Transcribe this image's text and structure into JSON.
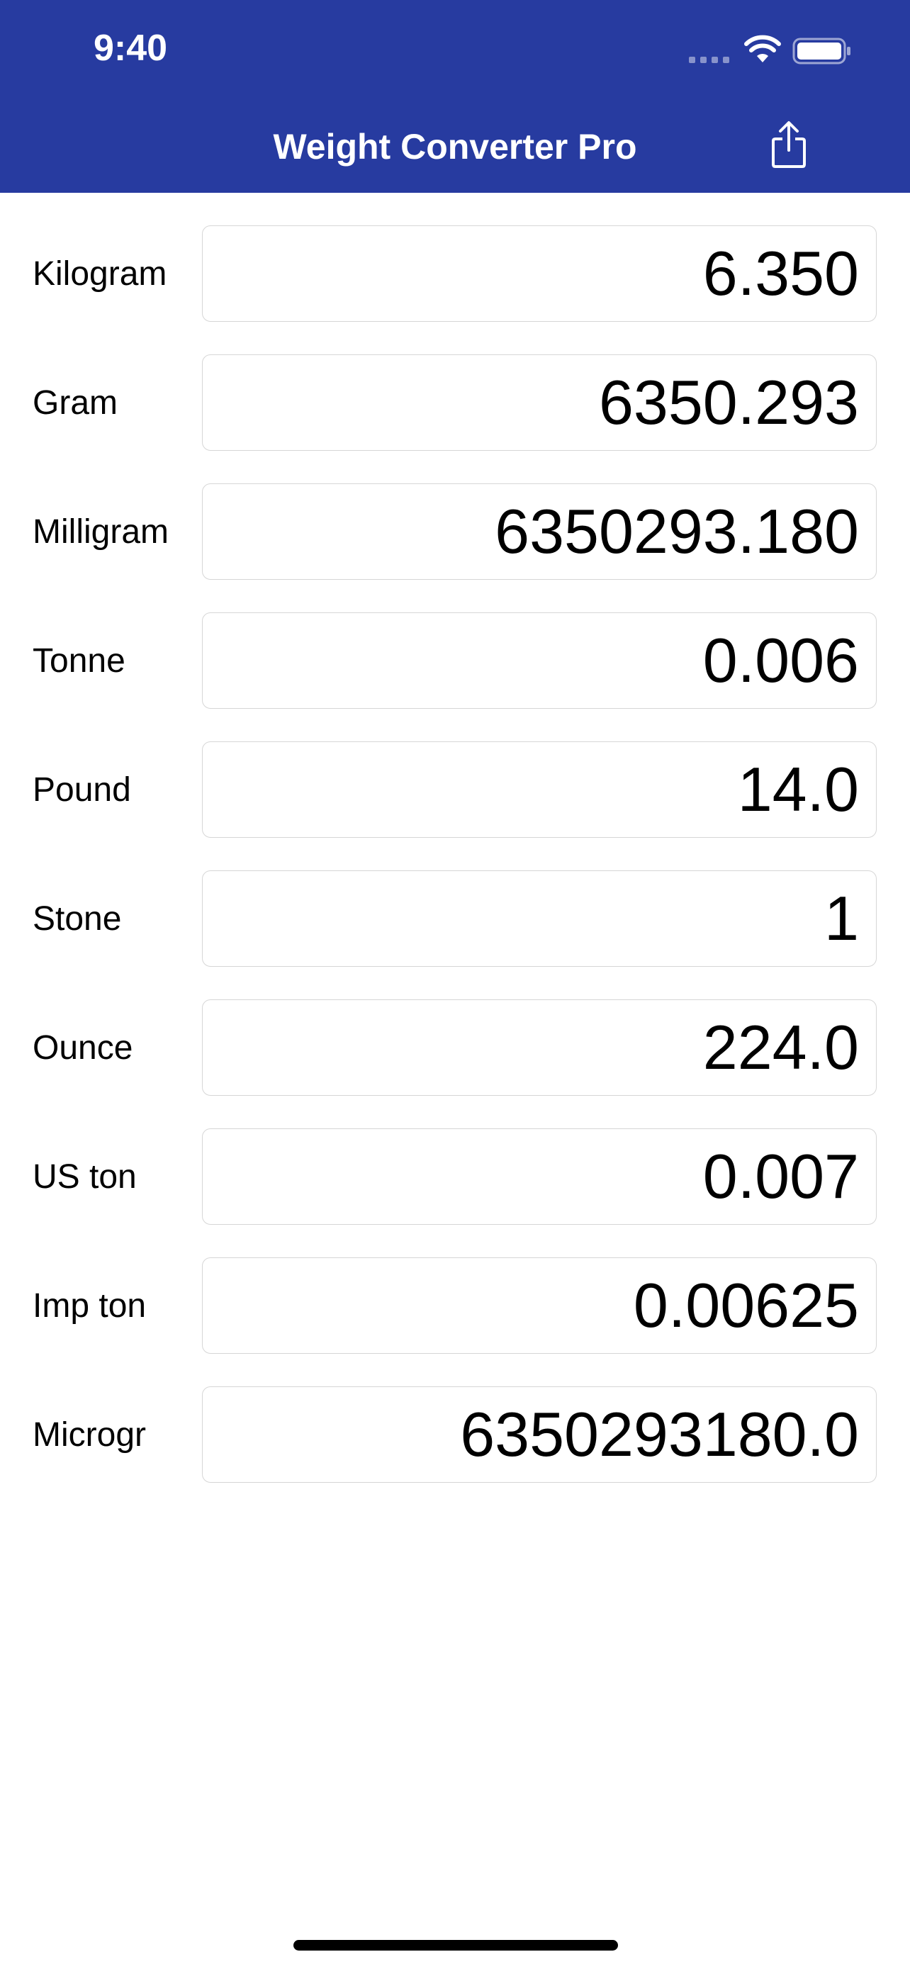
{
  "status_bar": {
    "time": "9:40",
    "icons": [
      "signal-icon",
      "wifi-icon",
      "battery-icon"
    ]
  },
  "nav": {
    "title": "Weight Converter Pro",
    "share_icon": "share-icon"
  },
  "colors": {
    "header_bg": "#273ba0",
    "header_text": "#ffffff",
    "field_border": "#d6d6d6",
    "text": "#000000"
  },
  "units": [
    {
      "label": "Kilogram",
      "value": "6.350"
    },
    {
      "label": "Gram",
      "value": "6350.293"
    },
    {
      "label": "Milligram",
      "value": "6350293.180"
    },
    {
      "label": "Tonne",
      "value": "0.006"
    },
    {
      "label": "Pound",
      "value": "14.0"
    },
    {
      "label": "Stone",
      "value": "1"
    },
    {
      "label": "Ounce",
      "value": "224.0"
    },
    {
      "label": "US ton",
      "value": "0.007"
    },
    {
      "label": "Imp ton",
      "value": "0.00625"
    },
    {
      "label": "Microgr",
      "value": "6350293180.0"
    }
  ]
}
